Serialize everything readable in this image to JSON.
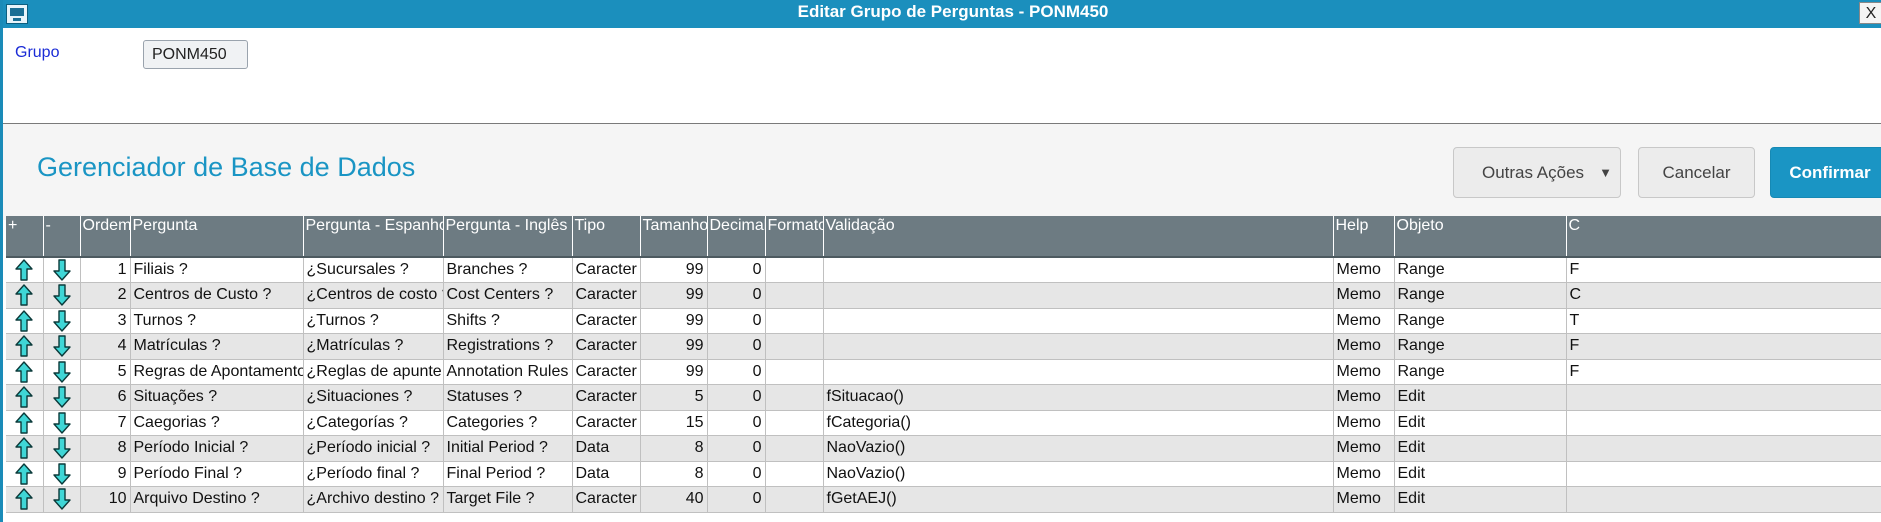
{
  "window": {
    "title": "Editar Grupo de Perguntas - PONM450",
    "close_label": "X"
  },
  "form": {
    "grupo_label": "Grupo",
    "grupo_value": "PONM450"
  },
  "header": {
    "title": "Gerenciador de Base de Dados",
    "outras_label": "Outras Ações",
    "cancel_label": "Cancelar",
    "confirm_label": "Confirmar"
  },
  "colors": {
    "accent": "#1a95c4",
    "grid_header": "#6d7b82",
    "arrow_fill": "#3fd6d6"
  },
  "grid": {
    "columns": [
      "+",
      "-",
      "Ordem",
      "Pergunta",
      "Pergunta - Espanhol",
      "Pergunta - Inglês",
      "Tipo",
      "Tamanho",
      "Decimal",
      "Formato",
      "Validação",
      "Help",
      "Objeto",
      "C"
    ],
    "rows": [
      {
        "ordem": "1",
        "pergunta": "Filiais ?",
        "espanhol": "¿Sucursales ?",
        "ingles": "Branches ?",
        "tipo": "Caracter",
        "tamanho": "99",
        "decimal": "0",
        "formato": "",
        "validacao": "",
        "help": "Memo",
        "objeto": "Range",
        "extra": "F"
      },
      {
        "ordem": "2",
        "pergunta": "Centros de Custo ?",
        "espanhol": "¿Centros de costo ?",
        "ingles": "Cost Centers ?",
        "tipo": "Caracter",
        "tamanho": "99",
        "decimal": "0",
        "formato": "",
        "validacao": "",
        "help": "Memo",
        "objeto": "Range",
        "extra": "C"
      },
      {
        "ordem": "3",
        "pergunta": "Turnos ?",
        "espanhol": "¿Turnos ?",
        "ingles": "Shifts ?",
        "tipo": "Caracter",
        "tamanho": "99",
        "decimal": "0",
        "formato": "",
        "validacao": "",
        "help": "Memo",
        "objeto": "Range",
        "extra": "T"
      },
      {
        "ordem": "4",
        "pergunta": "Matrículas ?",
        "espanhol": "¿Matrículas ?",
        "ingles": "Registrations ?",
        "tipo": "Caracter",
        "tamanho": "99",
        "decimal": "0",
        "formato": "",
        "validacao": "",
        "help": "Memo",
        "objeto": "Range",
        "extra": "F"
      },
      {
        "ordem": "5",
        "pergunta": "Regras de Apontamento ?",
        "espanhol": "¿Reglas de apunte ?",
        "ingles": "Annotation Rules ?",
        "tipo": "Caracter",
        "tamanho": "99",
        "decimal": "0",
        "formato": "",
        "validacao": "",
        "help": "Memo",
        "objeto": "Range",
        "extra": "F"
      },
      {
        "ordem": "6",
        "pergunta": "Situações ?",
        "espanhol": "¿Situaciones ?",
        "ingles": "Statuses ?",
        "tipo": "Caracter",
        "tamanho": "5",
        "decimal": "0",
        "formato": "",
        "validacao": "fSituacao()",
        "help": "Memo",
        "objeto": "Edit",
        "extra": ""
      },
      {
        "ordem": "7",
        "pergunta": "Caegorias ?",
        "espanhol": "¿Categorías ?",
        "ingles": "Categories ?",
        "tipo": "Caracter",
        "tamanho": "15",
        "decimal": "0",
        "formato": "",
        "validacao": "fCategoria()",
        "help": "Memo",
        "objeto": "Edit",
        "extra": ""
      },
      {
        "ordem": "8",
        "pergunta": "Período Inicial ?",
        "espanhol": "¿Período inicial ?",
        "ingles": "Initial Period ?",
        "tipo": "Data",
        "tamanho": "8",
        "decimal": "0",
        "formato": "",
        "validacao": "NaoVazio()",
        "help": "Memo",
        "objeto": "Edit",
        "extra": ""
      },
      {
        "ordem": "9",
        "pergunta": "Período Final ?",
        "espanhol": "¿Período final ?",
        "ingles": "Final Period ?",
        "tipo": "Data",
        "tamanho": "8",
        "decimal": "0",
        "formato": "",
        "validacao": "NaoVazio()",
        "help": "Memo",
        "objeto": "Edit",
        "extra": ""
      },
      {
        "ordem": "10",
        "pergunta": "Arquivo Destino ?",
        "espanhol": "¿Archivo destino ?",
        "ingles": "Target File ?",
        "tipo": "Caracter",
        "tamanho": "40",
        "decimal": "0",
        "formato": "",
        "validacao": "fGetAEJ()",
        "help": "Memo",
        "objeto": "Edit",
        "extra": ""
      }
    ]
  }
}
